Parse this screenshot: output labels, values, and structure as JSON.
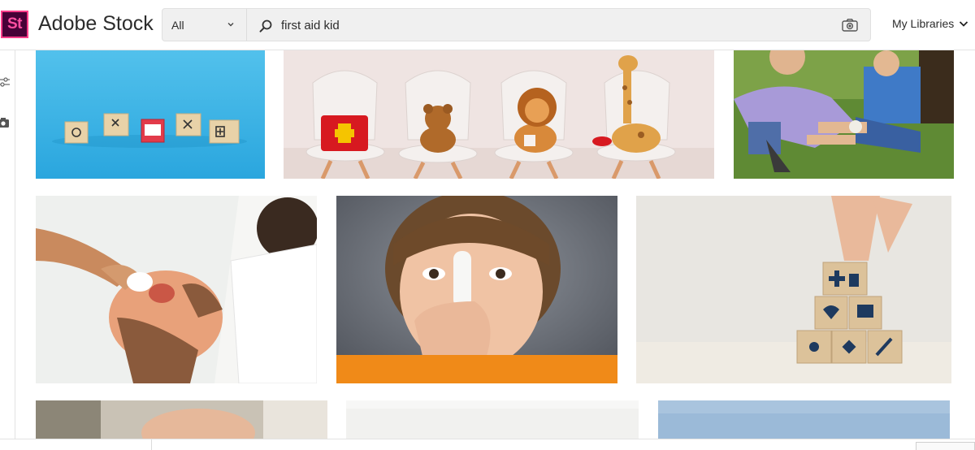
{
  "app": {
    "logo_mark": "St",
    "brand": "Adobe Stock",
    "accent_color": "#ff3d8a",
    "logo_bg_color": "#470137"
  },
  "search": {
    "scope": "All",
    "query": "first aid kid",
    "icons": [
      "search-icon",
      "camera-icon",
      "chevron-down-icon"
    ]
  },
  "header": {
    "libraries_label": "My Libraries"
  },
  "rail": {
    "icons": [
      "filter-icon",
      "camera-icon"
    ]
  },
  "results": [
    {
      "subject": "wooden blocks with medical icons on blue background"
    },
    {
      "subject": "first aid kit and stuffed toys on white chairs"
    },
    {
      "subject": "adult applying bandage to boy's knee on grass"
    },
    {
      "subject": "cleaning a child's scraped knee with cotton pad"
    },
    {
      "subject": "boy with bandaged finger in front of face"
    },
    {
      "subject": "hand stacking wooden blocks with health icons"
    },
    {
      "subject": "partially visible result"
    },
    {
      "subject": "partially visible result"
    },
    {
      "subject": "partially visible result"
    }
  ]
}
